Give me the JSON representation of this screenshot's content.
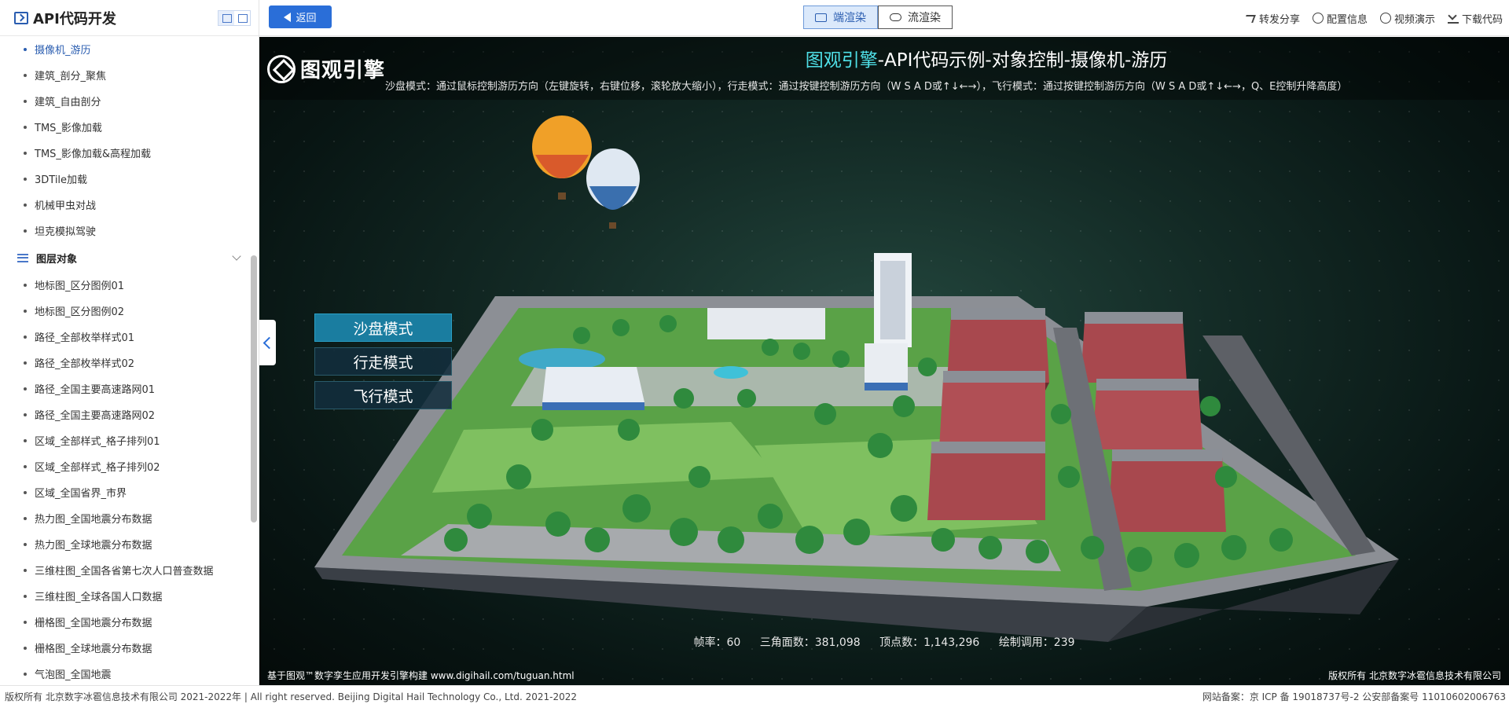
{
  "sidebar": {
    "title": "API代码开发",
    "items_top": [
      {
        "label": "摄像机_游历",
        "active": true
      },
      {
        "label": "建筑_剖分_聚焦"
      },
      {
        "label": "建筑_自由剖分"
      },
      {
        "label": "TMS_影像加载"
      },
      {
        "label": "TMS_影像加载&高程加载"
      },
      {
        "label": "3DTile加载"
      },
      {
        "label": "机械甲虫对战"
      },
      {
        "label": "坦克模拟驾驶"
      }
    ],
    "group_label": "图层对象",
    "items_group": [
      {
        "label": "地标图_区分图例01"
      },
      {
        "label": "地标图_区分图例02"
      },
      {
        "label": "路径_全部枚举样式01"
      },
      {
        "label": "路径_全部枚举样式02"
      },
      {
        "label": "路径_全国主要高速路网01"
      },
      {
        "label": "路径_全国主要高速路网02"
      },
      {
        "label": "区域_全部样式_格子排列01"
      },
      {
        "label": "区域_全部样式_格子排列02"
      },
      {
        "label": "区域_全国省界_市界"
      },
      {
        "label": "热力图_全国地震分布数据"
      },
      {
        "label": "热力图_全球地震分布数据"
      },
      {
        "label": "三维柱图_全国各省第七次人口普查数据"
      },
      {
        "label": "三维柱图_全球各国人口数据"
      },
      {
        "label": "栅格图_全国地震分布数据"
      },
      {
        "label": "栅格图_全球地震分布数据"
      },
      {
        "label": "气泡图_全国地震"
      }
    ]
  },
  "toolbar": {
    "back_label": "返回",
    "render_client": "端渲染",
    "render_stream": "流渲染",
    "share": "转发分享",
    "config": "配置信息",
    "video": "视频演示",
    "download": "下载代码"
  },
  "viewport": {
    "brand": "图观引擎",
    "title_highlight": "图观引擎",
    "title_rest": "-API代码示例-对象控制-摄像机-游历",
    "subtitle": "沙盘模式：通过鼠标控制游历方向（左键旋转，右键位移，滚轮放大缩小），行走模式：通过按键控制游历方向（W S A D或↑↓←→），飞行模式：通过按键控制游历方向（W S A D或↑↓←→，Q、E控制升降高度）",
    "modes": [
      "沙盘模式",
      "行走模式",
      "飞行模式"
    ],
    "stats": {
      "fps": "帧率：60",
      "triangles": "三角面数：381,098",
      "vertices": "顶点数：1,143,296",
      "drawcalls": "绘制调用：239"
    },
    "footer_left": "基于图观™数字孪生应用开发引擎构建 www.digihail.com/tuguan.html",
    "footer_right": "版权所有 北京数字冰雹信息技术有限公司"
  },
  "page_footer": {
    "left": "版权所有 北京数字冰雹信息技术有限公司 2021-2022年 | All right reserved. Beijing Digital Hail Technology Co., Ltd. 2021-2022",
    "right": "网站备案：京 ICP 备 19018737号-2 公安部备案号 11010602006763"
  },
  "colors": {
    "accent": "#2a6ed8",
    "title_highlight": "#4fe0e8",
    "mode_active": "#1a7da0"
  }
}
